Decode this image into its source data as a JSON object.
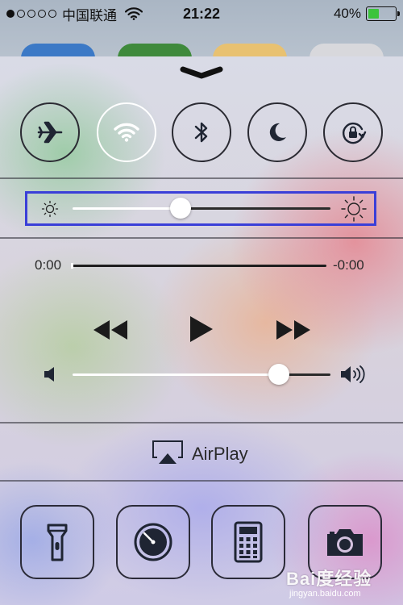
{
  "status_bar": {
    "carrier": "中国联通",
    "time": "21:22",
    "battery_percent": "40%",
    "battery_level": 0.4,
    "signal_bars_filled": 1,
    "signal_bars_total": 5
  },
  "toggles": [
    {
      "name": "airplane-mode",
      "icon": "airplane-icon",
      "active": false
    },
    {
      "name": "wifi",
      "icon": "wifi-icon",
      "active": true
    },
    {
      "name": "bluetooth",
      "icon": "bluetooth-icon",
      "active": false
    },
    {
      "name": "do-not-disturb",
      "icon": "moon-icon",
      "active": false
    },
    {
      "name": "rotation-lock",
      "icon": "rotation-lock-icon",
      "active": false
    }
  ],
  "brightness": {
    "level": 0.42,
    "highlight_color": "#3a3fd8"
  },
  "music": {
    "elapsed": "0:00",
    "remaining": "-0:00",
    "progress": 0.0,
    "volume": 0.8
  },
  "airplay": {
    "label": "AirPlay"
  },
  "shortcuts": [
    {
      "name": "flashlight",
      "icon": "flashlight-icon"
    },
    {
      "name": "timer",
      "icon": "timer-icon"
    },
    {
      "name": "calculator",
      "icon": "calculator-icon"
    },
    {
      "name": "camera",
      "icon": "camera-icon"
    }
  ],
  "watermark": {
    "text": "Bai度经验",
    "url": "jingyan.baidu.com"
  },
  "colors": {
    "active_toggle_border": "#ffffff",
    "icon_dark": "#1f2533",
    "battery_fill": "#3cc43c"
  }
}
